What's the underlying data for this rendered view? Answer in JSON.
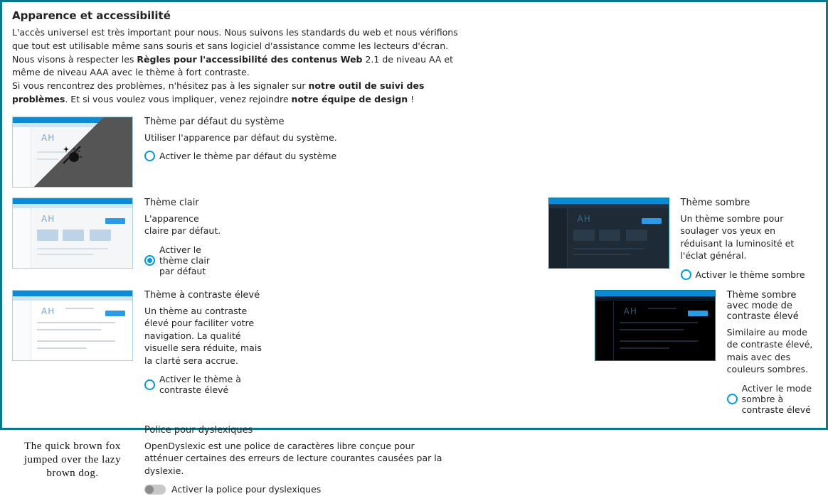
{
  "title": "Apparence et accessibilité",
  "intro": {
    "p1a": "L'accès universel est très important pour nous. Nous suivons les standards du web et nous vérifions que tout est utilisable même sans souris et sans logiciel d'assistance comme les lecteurs d'écran. Nous visons à respecter les ",
    "p1b": "Règles pour l'accessibilité des contenus Web",
    "p1c": " 2.1 de niveau AA et même de niveau AAA avec le thème à fort contraste.",
    "p2a": "Si vous rencontrez des problèmes, n'hésitez pas à les signaler sur ",
    "p2b": "notre outil de suivi des problèmes",
    "p2c": ". Et si vous voulez vous impliquer, venez rejoindre ",
    "p2d": "notre équipe de design",
    "p2e": " !"
  },
  "themes": {
    "system": {
      "title": "Thème par défaut du système",
      "desc": "Utiliser l'apparence par défaut du système.",
      "action": "Activer le thème par défaut du système"
    },
    "light": {
      "title": "Thème clair",
      "desc": "L'apparence claire par défaut.",
      "action": "Activer le thème clair par défaut"
    },
    "dark": {
      "title": "Thème sombre",
      "desc": "Un thème sombre pour soulager vos yeux en réduisant la luminosité et l'éclat général.",
      "action": "Activer le thème sombre"
    },
    "contrast": {
      "title": "Thème à contraste élevé",
      "desc": "Un thème au contraste élevé pour faciliter votre navigation. La qualité visuelle sera réduite, mais la clarté sera accrue.",
      "action": "Activer le thème à contraste élevé"
    },
    "darkcontrast": {
      "title": "Thème sombre avec mode de contraste élevé",
      "desc": "Similaire au mode de contraste élevé, mais avec des couleurs sombres.",
      "action": "Activer le mode sombre à contraste élevé"
    }
  },
  "dyslexic": {
    "title": "Police pour dyslexiques",
    "desc": "OpenDyslexic est une police de caractères libre conçue pour atténuer certaines des erreurs de lecture courantes causées par la dyslexie.",
    "action": "Activer la police pour dyslexiques",
    "sample": "The quick brown fox jumped over the lazy brown dog."
  },
  "preview": {
    "ah": "AH"
  }
}
